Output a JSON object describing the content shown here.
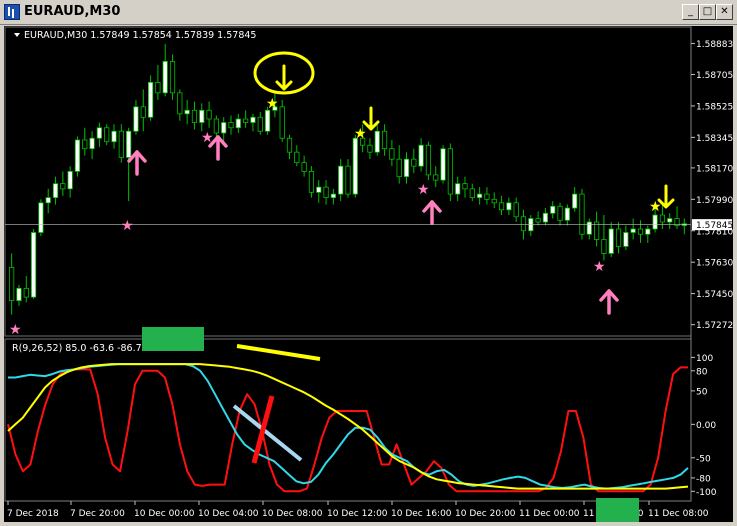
{
  "window": {
    "title": "EURAUD,M30",
    "buttons": {
      "minimize": "_",
      "maximize": "□",
      "close": "✕"
    }
  },
  "colors": {
    "background": "#000000",
    "bull_candle": "#ffffff",
    "bear_candle": "#000000",
    "wick": "#00c000",
    "grid": "#2a2a2a",
    "text": "#ffffff",
    "osc_red": "#ff1010",
    "osc_cyan": "#30d8e8",
    "osc_yellow": "#ffff00",
    "marker_pink": "#ff7fbf",
    "marker_yellow": "#ffff00",
    "green_block": "#22b14c",
    "light_blue_line": "#a8d8f0"
  },
  "chart_data": [
    {
      "type": "candlestick",
      "title": "EURAUD,M30  1.57849 1.57854 1.57839 1.57845",
      "y_ticks": [
        "1.58883",
        "1.58705",
        "1.58525",
        "1.58345",
        "1.58170",
        "1.57990",
        "1.57810",
        "1.57630",
        "1.57450",
        "1.57272"
      ],
      "y_tick_values": [
        1.58883,
        1.58705,
        1.58525,
        1.58345,
        1.5817,
        1.5799,
        1.5781,
        1.5763,
        1.5745,
        1.57272
      ],
      "ylim": [
        1.5723,
        1.5896
      ],
      "current_price": "1.57845",
      "current_price_value": 1.57845,
      "grid": false,
      "candles": [
        [
          1.576,
          1.5768,
          1.5733,
          1.5741
        ],
        [
          1.5741,
          1.575,
          1.5738,
          1.5748
        ],
        [
          1.5748,
          1.5755,
          1.574,
          1.5743
        ],
        [
          1.5743,
          1.5782,
          1.5742,
          1.578
        ],
        [
          1.578,
          1.5799,
          1.5778,
          1.5797
        ],
        [
          1.5797,
          1.5805,
          1.5791,
          1.58
        ],
        [
          1.58,
          1.5812,
          1.5796,
          1.5808
        ],
        [
          1.5808,
          1.5815,
          1.5801,
          1.5805
        ],
        [
          1.5805,
          1.5818,
          1.58,
          1.5815
        ],
        [
          1.5815,
          1.5835,
          1.5812,
          1.5833
        ],
        [
          1.5833,
          1.584,
          1.5824,
          1.5828
        ],
        [
          1.5828,
          1.5838,
          1.5822,
          1.5834
        ],
        [
          1.5834,
          1.5843,
          1.5829,
          1.584
        ],
        [
          1.584,
          1.5842,
          1.583,
          1.5832
        ],
        [
          1.5832,
          1.5842,
          1.5828,
          1.5838
        ],
        [
          1.5838,
          1.5842,
          1.582,
          1.5823
        ],
        [
          1.5823,
          1.584,
          1.5798,
          1.5838
        ],
        [
          1.5838,
          1.5856,
          1.5836,
          1.5852
        ],
        [
          1.5852,
          1.5862,
          1.5838,
          1.5846
        ],
        [
          1.5846,
          1.587,
          1.5844,
          1.5866
        ],
        [
          1.5866,
          1.5876,
          1.5856,
          1.586
        ],
        [
          1.586,
          1.5888,
          1.5858,
          1.5878
        ],
        [
          1.5878,
          1.5882,
          1.5856,
          1.586
        ],
        [
          1.586,
          1.5862,
          1.5844,
          1.5848
        ],
        [
          1.5848,
          1.5856,
          1.5842,
          1.585
        ],
        [
          1.585,
          1.5855,
          1.5839,
          1.5843
        ],
        [
          1.5843,
          1.5854,
          1.5838,
          1.585
        ],
        [
          1.585,
          1.5855,
          1.584,
          1.5845
        ],
        [
          1.5845,
          1.5847,
          1.5834,
          1.5837
        ],
        [
          1.5837,
          1.5846,
          1.5832,
          1.5843
        ],
        [
          1.5843,
          1.5847,
          1.5836,
          1.584
        ],
        [
          1.584,
          1.5848,
          1.5837,
          1.5845
        ],
        [
          1.5845,
          1.585,
          1.584,
          1.5843
        ],
        [
          1.5843,
          1.5848,
          1.5838,
          1.5846
        ],
        [
          1.5846,
          1.5849,
          1.5836,
          1.5838
        ],
        [
          1.5838,
          1.5852,
          1.5836,
          1.585
        ],
        [
          1.585,
          1.586,
          1.5846,
          1.5852
        ],
        [
          1.5852,
          1.5856,
          1.5832,
          1.5834
        ],
        [
          1.5834,
          1.5836,
          1.5822,
          1.5826
        ],
        [
          1.5826,
          1.583,
          1.5818,
          1.582
        ],
        [
          1.582,
          1.5824,
          1.5812,
          1.5815
        ],
        [
          1.5815,
          1.5818,
          1.58,
          1.5803
        ],
        [
          1.5803,
          1.581,
          1.5797,
          1.5806
        ],
        [
          1.5806,
          1.581,
          1.5796,
          1.58
        ],
        [
          1.58,
          1.5805,
          1.5796,
          1.5802
        ],
        [
          1.5802,
          1.5822,
          1.5798,
          1.5818
        ],
        [
          1.5818,
          1.5822,
          1.58,
          1.5802
        ],
        [
          1.5802,
          1.5836,
          1.58,
          1.5834
        ],
        [
          1.5834,
          1.5842,
          1.5826,
          1.583
        ],
        [
          1.583,
          1.5834,
          1.5822,
          1.5826
        ],
        [
          1.5826,
          1.5842,
          1.5824,
          1.5838
        ],
        [
          1.5838,
          1.5842,
          1.5824,
          1.5828
        ],
        [
          1.5828,
          1.5833,
          1.5818,
          1.5822
        ],
        [
          1.5822,
          1.583,
          1.5808,
          1.5812
        ],
        [
          1.5812,
          1.5826,
          1.5808,
          1.5822
        ],
        [
          1.5822,
          1.5828,
          1.5814,
          1.5818
        ],
        [
          1.5818,
          1.5834,
          1.5815,
          1.583
        ],
        [
          1.583,
          1.5832,
          1.581,
          1.5813
        ],
        [
          1.5813,
          1.5818,
          1.5806,
          1.581
        ],
        [
          1.581,
          1.583,
          1.5808,
          1.5828
        ],
        [
          1.5828,
          1.5831,
          1.5798,
          1.5802
        ],
        [
          1.5802,
          1.5812,
          1.5798,
          1.5808
        ],
        [
          1.5808,
          1.5812,
          1.58,
          1.5805
        ],
        [
          1.5805,
          1.5808,
          1.5798,
          1.58
        ],
        [
          1.58,
          1.5806,
          1.5796,
          1.5802
        ],
        [
          1.5802,
          1.5806,
          1.5796,
          1.5799
        ],
        [
          1.5799,
          1.5803,
          1.5794,
          1.5797
        ],
        [
          1.5797,
          1.5801,
          1.579,
          1.5793
        ],
        [
          1.5793,
          1.58,
          1.579,
          1.5797
        ],
        [
          1.5797,
          1.58,
          1.5786,
          1.5789
        ],
        [
          1.5789,
          1.5793,
          1.5776,
          1.5781
        ],
        [
          1.5781,
          1.579,
          1.5778,
          1.5788
        ],
        [
          1.5788,
          1.5792,
          1.5784,
          1.5786
        ],
        [
          1.5786,
          1.5794,
          1.5784,
          1.5791
        ],
        [
          1.5791,
          1.5798,
          1.5788,
          1.5795
        ],
        [
          1.5795,
          1.5797,
          1.5784,
          1.5787
        ],
        [
          1.5787,
          1.5796,
          1.5784,
          1.5794
        ],
        [
          1.5794,
          1.5806,
          1.5792,
          1.5802
        ],
        [
          1.5802,
          1.5805,
          1.5776,
          1.5779
        ],
        [
          1.5779,
          1.5788,
          1.5776,
          1.5786
        ],
        [
          1.5786,
          1.5792,
          1.5772,
          1.5776
        ],
        [
          1.5776,
          1.579,
          1.5764,
          1.5768
        ],
        [
          1.5768,
          1.5786,
          1.5766,
          1.5782
        ],
        [
          1.5782,
          1.5786,
          1.5768,
          1.5772
        ],
        [
          1.5772,
          1.5784,
          1.577,
          1.578
        ],
        [
          1.578,
          1.5788,
          1.5776,
          1.5782
        ],
        [
          1.5782,
          1.5787,
          1.5774,
          1.5779
        ],
        [
          1.5779,
          1.5784,
          1.5774,
          1.5782
        ],
        [
          1.5782,
          1.5794,
          1.578,
          1.579
        ],
        [
          1.579,
          1.5796,
          1.5782,
          1.5786
        ],
        [
          1.5786,
          1.5791,
          1.5782,
          1.5788
        ],
        [
          1.5788,
          1.5795,
          1.5782,
          1.5784
        ],
        [
          1.5784,
          1.5788,
          1.5779,
          1.5785
        ]
      ]
    },
    {
      "type": "line",
      "title": "R(9,26,52) 85.0 -63.6 -86.7",
      "y_ticks": [
        "100",
        "80",
        "50",
        "0.00",
        "-50",
        "-80",
        "-100"
      ],
      "y_tick_values": [
        100,
        80,
        50,
        0,
        -50,
        -80,
        -100
      ],
      "ylim": [
        -110,
        120
      ],
      "grid": false,
      "series": [
        {
          "color": "#ff1010",
          "values": [
            0,
            -45,
            -70,
            -60,
            -10,
            30,
            60,
            75,
            80,
            82,
            82,
            82,
            45,
            -20,
            -60,
            -70,
            -10,
            60,
            80,
            80,
            80,
            70,
            30,
            -30,
            -70,
            -90,
            -92,
            -90,
            -90,
            -90,
            -30,
            20,
            45,
            30,
            -10,
            -60,
            -90,
            -100,
            -100,
            -100,
            -96,
            -60,
            -20,
            10,
            20,
            20,
            20,
            20,
            20,
            -20,
            -60,
            -60,
            -30,
            -60,
            -90,
            -80,
            -70,
            -55,
            -65,
            -90,
            -100,
            -100,
            -100,
            -100,
            -100,
            -100,
            -100,
            -100,
            -100,
            -100,
            -100,
            -100,
            -95,
            -80,
            -40,
            20,
            20,
            -20,
            -90,
            -100,
            -100,
            -100,
            -100,
            -100,
            -100,
            -100,
            -90,
            -50,
            20,
            75,
            85,
            85
          ]
        },
        {
          "color": "#30d8e8",
          "values": [
            70,
            70,
            72,
            74,
            73,
            72,
            75,
            79,
            81,
            82,
            84,
            86,
            87,
            88,
            89,
            90,
            90,
            90,
            90,
            90,
            90,
            90,
            90,
            90,
            90,
            87,
            80,
            65,
            45,
            25,
            5,
            -15,
            -30,
            -38,
            -45,
            -50,
            -55,
            -65,
            -75,
            -85,
            -88,
            -86,
            -75,
            -58,
            -45,
            -30,
            -15,
            -5,
            -5,
            -8,
            -20,
            -35,
            -45,
            -50,
            -55,
            -65,
            -72,
            -75,
            -70,
            -68,
            -75,
            -85,
            -90,
            -92,
            -90,
            -88,
            -85,
            -82,
            -80,
            -78,
            -80,
            -85,
            -90,
            -92,
            -94,
            -95,
            -94,
            -92,
            -90,
            -93,
            -95,
            -96,
            -95,
            -94,
            -92,
            -90,
            -88,
            -86,
            -84,
            -82,
            -80,
            -75,
            -65
          ]
        },
        {
          "color": "#ffff00",
          "values": [
            -10,
            0,
            10,
            25,
            40,
            55,
            65,
            72,
            78,
            82,
            85,
            87,
            88,
            89,
            90,
            90,
            90,
            90,
            90,
            90,
            90,
            90,
            90,
            90,
            90,
            90,
            90,
            89,
            88,
            87,
            86,
            84,
            82,
            80,
            77,
            73,
            68,
            63,
            58,
            53,
            48,
            42,
            35,
            28,
            22,
            15,
            8,
            0,
            -8,
            -18,
            -28,
            -38,
            -48,
            -55,
            -60,
            -65,
            -72,
            -78,
            -82,
            -84,
            -86,
            -88,
            -89,
            -90,
            -91,
            -92,
            -93,
            -94,
            -95,
            -96,
            -96,
            -96,
            -96,
            -96,
            -96,
            -96,
            -96,
            -96,
            -96,
            -96,
            -96,
            -96,
            -96,
            -96,
            -96,
            -96,
            -96,
            -96,
            -96,
            -96,
            -95,
            -94,
            -93
          ]
        }
      ]
    }
  ],
  "x_labels": [
    "7 Dec 2018",
    "7 Dec 20:00",
    "10 Dec 00:00",
    "10 Dec 04:00",
    "10 Dec 08:00",
    "10 Dec 12:00",
    "10 Dec 16:00",
    "10 Dec 20:00",
    "11 Dec 00:00",
    "11 Dec 04:00",
    "11 Dec 08:00"
  ]
}
